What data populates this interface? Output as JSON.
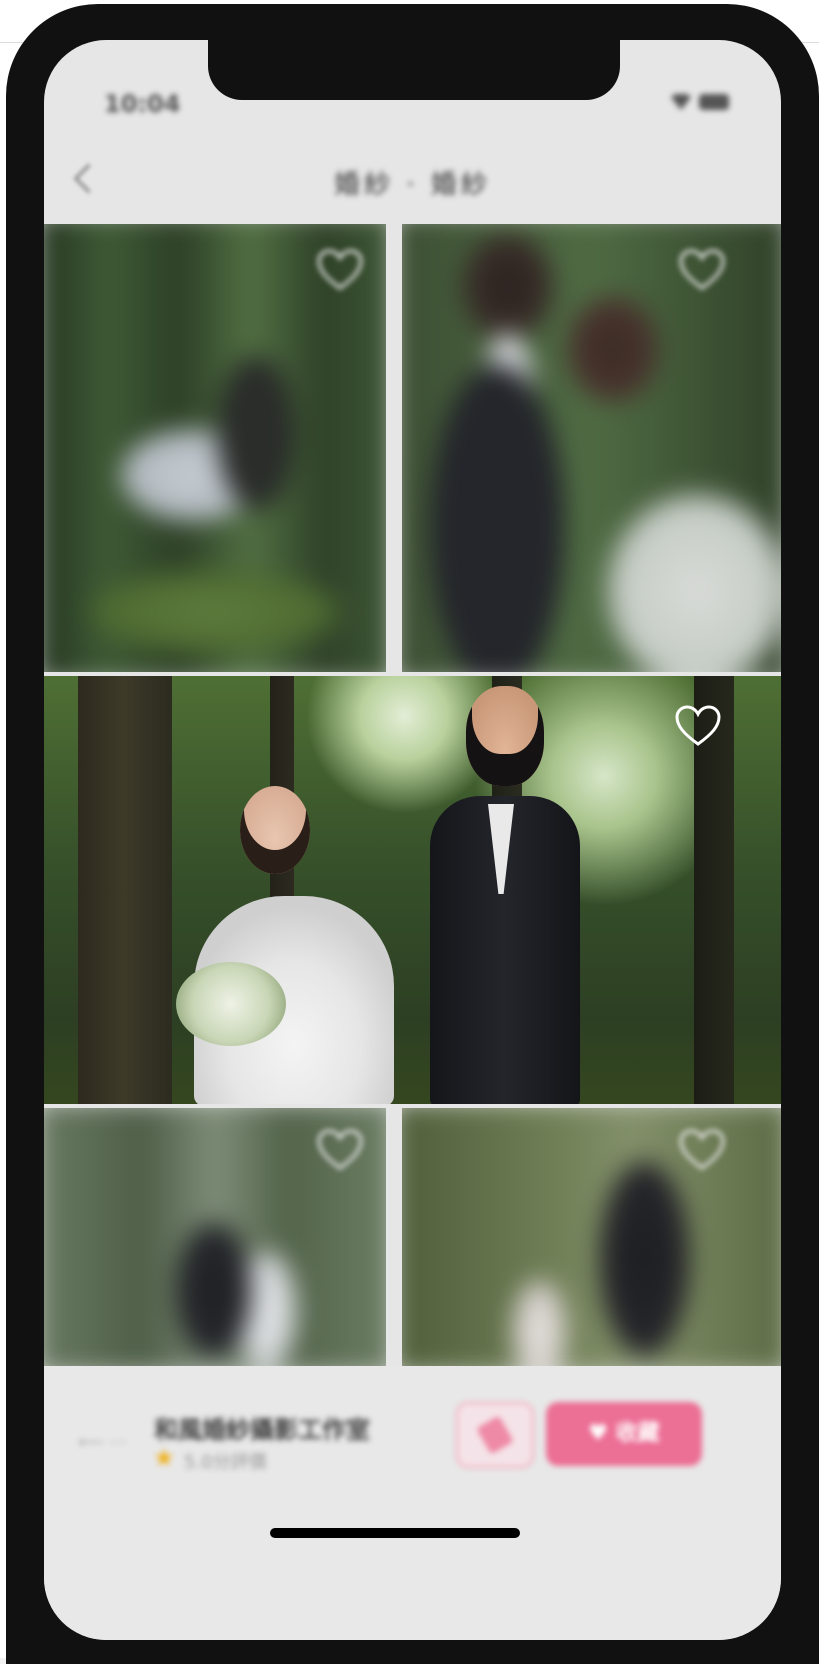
{
  "status_bar": {
    "time": "10:04"
  },
  "nav": {
    "title": "婚紗 · 婚紗"
  },
  "photos": [
    {
      "caption": "",
      "favorited": false
    },
    {
      "caption": "",
      "favorited": false
    },
    {
      "caption": "",
      "favorited": false
    },
    {
      "caption": "",
      "favorited": false
    },
    {
      "caption": "",
      "favorited": false
    }
  ],
  "bottom_bar": {
    "studio_name": "和風婚紗攝影工作室",
    "rating_text": "5.0分評價",
    "follow_label": "♥ 收藏"
  },
  "colors": {
    "accent": "#ec6f95",
    "accent_light": "#f3a8bb",
    "frame": "#111111",
    "star": "#f0b21f"
  }
}
